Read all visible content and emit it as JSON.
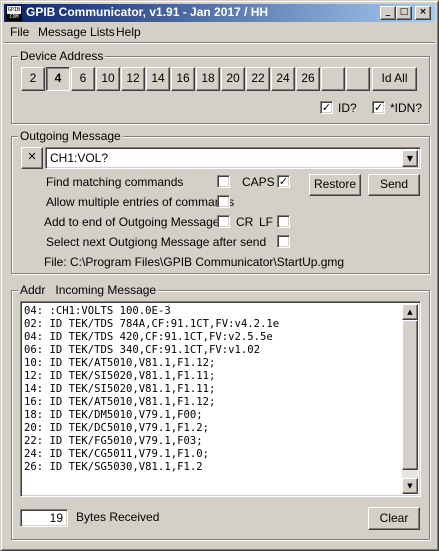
{
  "window": {
    "title": "GPIB Communicator, v1.91 - Jan 2017 / HH",
    "icon_text": [
      "GPIB",
      "COM"
    ],
    "controls": [
      "_",
      "□",
      "×"
    ]
  },
  "menu": [
    "File",
    "Message Lists",
    "Help"
  ],
  "device_address": {
    "label": "Device Address",
    "buttons": [
      "2",
      "4",
      "6",
      "10",
      "12",
      "14",
      "16",
      "18",
      "20",
      "22",
      "24",
      "26",
      "",
      "",
      ""
    ],
    "selected": "4",
    "id_all": "Id All",
    "id_check_label": "ID?",
    "id_checked": "✓",
    "idn_check_label": "*IDN?",
    "idn_checked": "✓"
  },
  "outgoing": {
    "label": "Outgoing Message",
    "clear_icon": "×",
    "value": "CH1:VOL?",
    "find_matching": "Find matching commands",
    "caps_label": "CAPS",
    "caps_checked": "✓",
    "restore_label": "Restore",
    "send_label": "Send",
    "allow_multiple": "Allow multiple entries of commands",
    "add_to_end": "Add to end of Outgoing Message:",
    "cr_label": "CR",
    "lf_label": "LF",
    "select_next": "Select next Outgiong Message after send",
    "file_line": "File:  C:\\Program Files\\GPIB Communicator\\StartUp.gmg"
  },
  "incoming": {
    "addr_label": "Addr",
    "label": "Incoming Message",
    "lines": [
      "04: :CH1:VOLTS 100.0E-3",
      "02: ID TEK/TDS 784A,CF:91.1CT,FV:v4.2.1e",
      "04: ID TEK/TDS 420,CF:91.1CT,FV:v2.5.5e",
      "06: ID TEK/TDS 340,CF:91.1CT,FV:v1.02",
      "10: ID TEK/AT5010,V81.1,F1.12;",
      "12: ID TEK/SI5020,V81.1,F1.11;",
      "14: ID TEK/SI5020,V81.1,F1.11;",
      "16: ID TEK/AT5010,V81.1,F1.12;",
      "18: ID TEK/DM5010,V79.1,F00;",
      "20: ID TEK/DC5010,V79.1,F1.2;",
      "22: ID TEK/FG5010,V79.1,F03;",
      "24: ID TEK/CG5011,V79.1,F1.0;",
      "26: ID TEK/SG5030,V81.1,F1.2"
    ],
    "bytes_value": "19",
    "bytes_label": "Bytes Received",
    "clear_label": "Clear"
  }
}
